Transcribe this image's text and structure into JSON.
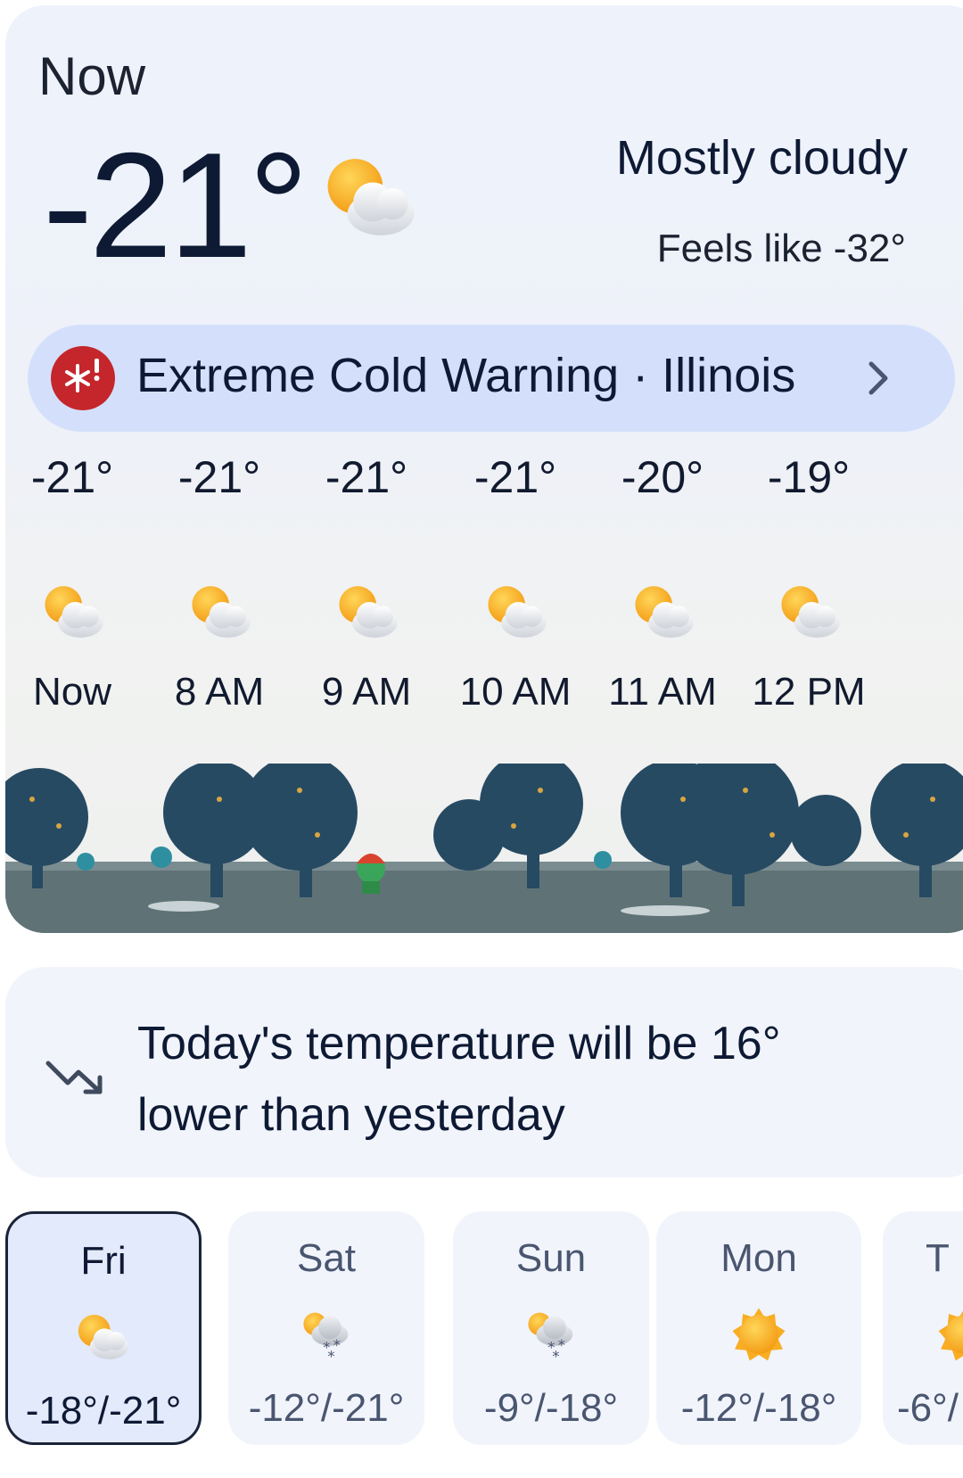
{
  "current": {
    "label": "Now",
    "temperature": "-21°",
    "condition": "Mostly cloudy",
    "feels_like": "Feels like -32°",
    "icon": "mostly-cloudy-icon"
  },
  "alert": {
    "text": "Extreme Cold Warning · Illinois",
    "icon": "cold-warning-icon",
    "color": "#c4262c"
  },
  "hourly": [
    {
      "temp": "-21°",
      "label": "Now",
      "icon": "mostly-cloudy-icon"
    },
    {
      "temp": "-21°",
      "label": "8 AM",
      "icon": "mostly-cloudy-icon"
    },
    {
      "temp": "-21°",
      "label": "9 AM",
      "icon": "mostly-cloudy-icon"
    },
    {
      "temp": "-21°",
      "label": "10 AM",
      "icon": "partly-cloudy-icon"
    },
    {
      "temp": "-20°",
      "label": "11 AM",
      "icon": "partly-cloudy-icon"
    },
    {
      "temp": "-19°",
      "label": "12 PM",
      "icon": "partly-cloudy-icon"
    }
  ],
  "trend": {
    "text": "Today's temperature will be 16° lower than yesterday",
    "icon": "trending-down-icon"
  },
  "daily": [
    {
      "day": "Fri",
      "range": "-18°/-21°",
      "icon": "mostly-cloudy-icon",
      "selected": true
    },
    {
      "day": "Sat",
      "range": "-12°/-21°",
      "icon": "snow-showers-icon"
    },
    {
      "day": "Sun",
      "range": "-9°/-18°",
      "icon": "snow-showers-icon"
    },
    {
      "day": "Mon",
      "range": "-12°/-18°",
      "icon": "sunny-icon"
    },
    {
      "day": "T",
      "range": "-6°/",
      "icon": "sunny-icon"
    }
  ],
  "colors": {
    "accent_alert_bg": "#d4e0fb",
    "sun": "#f6a623",
    "text": "#0e1a34"
  }
}
